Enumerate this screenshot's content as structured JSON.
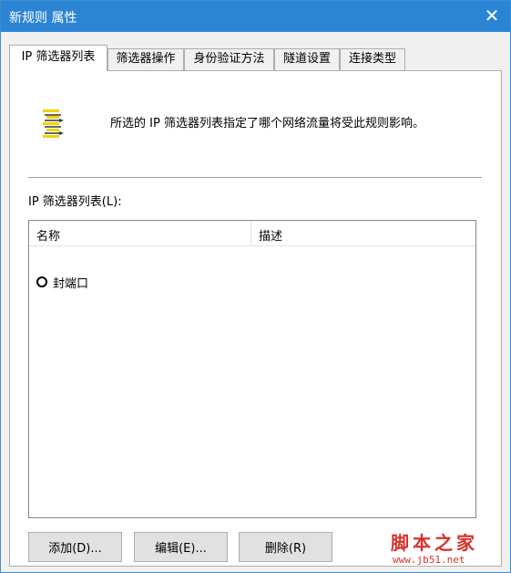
{
  "window": {
    "title": "新规则 属性",
    "close_glyph": "✕"
  },
  "tabs": [
    {
      "label": "IP 筛选器列表",
      "active": true
    },
    {
      "label": "筛选器操作",
      "active": false
    },
    {
      "label": "身份验证方法",
      "active": false
    },
    {
      "label": "隧道设置",
      "active": false
    },
    {
      "label": "连接类型",
      "active": false
    }
  ],
  "info": {
    "icon": "filter-list-icon",
    "text": "所选的 IP 筛选器列表指定了哪个网络流量将受此规则影响。"
  },
  "filter_list": {
    "label": "IP 筛选器列表(L):",
    "columns": [
      "名称",
      "描述"
    ],
    "rows": [
      {
        "name": "封端口",
        "description": "",
        "selected": false
      }
    ]
  },
  "buttons": {
    "add": "添加(D)...",
    "edit": "编辑(E)...",
    "delete": "删除(R)"
  },
  "watermark": {
    "text": "脚本之家",
    "url": "www.jb51.net"
  },
  "colors": {
    "titlebar": "#2b84d4",
    "watermark": "#d8312a"
  }
}
